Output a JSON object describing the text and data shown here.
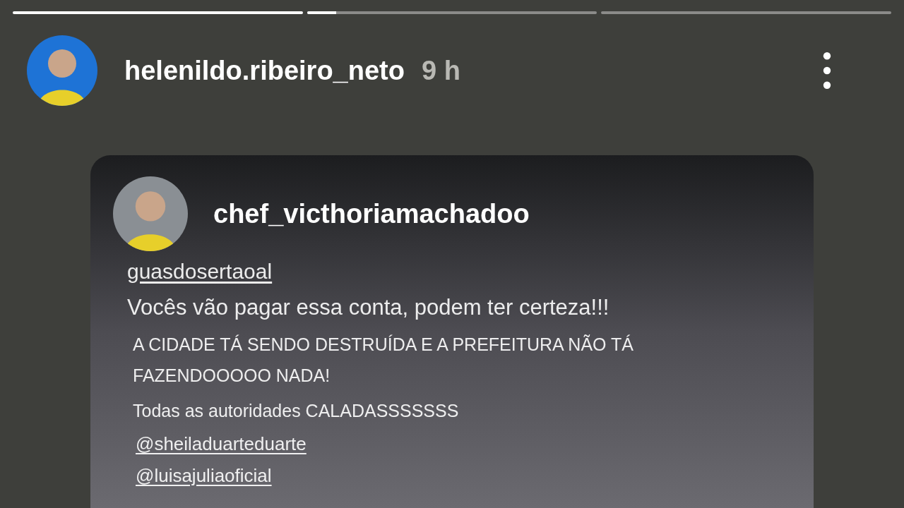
{
  "progress": [
    {
      "level": 1
    },
    {
      "level": 0.1
    },
    {
      "level": 0
    }
  ],
  "header": {
    "username": "helenildo.ribeiro_neto",
    "time": "9 h"
  },
  "shared_post": {
    "author": "chef_victhoriamachadoo",
    "lines": [
      {
        "kind": "mention",
        "text": "guasdosertaoal"
      },
      {
        "kind": "caption",
        "text": "Vocês vão pagar essa conta, podem ter certeza!!!"
      },
      {
        "kind": "shout",
        "text": "A CIDADE TÁ SENDO DESTRUÍDA E A PREFEITURA NÃO TÁ FAZENDOOOOO NADA!"
      },
      {
        "kind": "shout",
        "text": "Todas as autoridades CALADASSSSSSS"
      },
      {
        "kind": "mention",
        "text": "@sheiladuarteduarte"
      },
      {
        "kind": "mention",
        "text": "@luisajuliaoficial"
      }
    ]
  }
}
